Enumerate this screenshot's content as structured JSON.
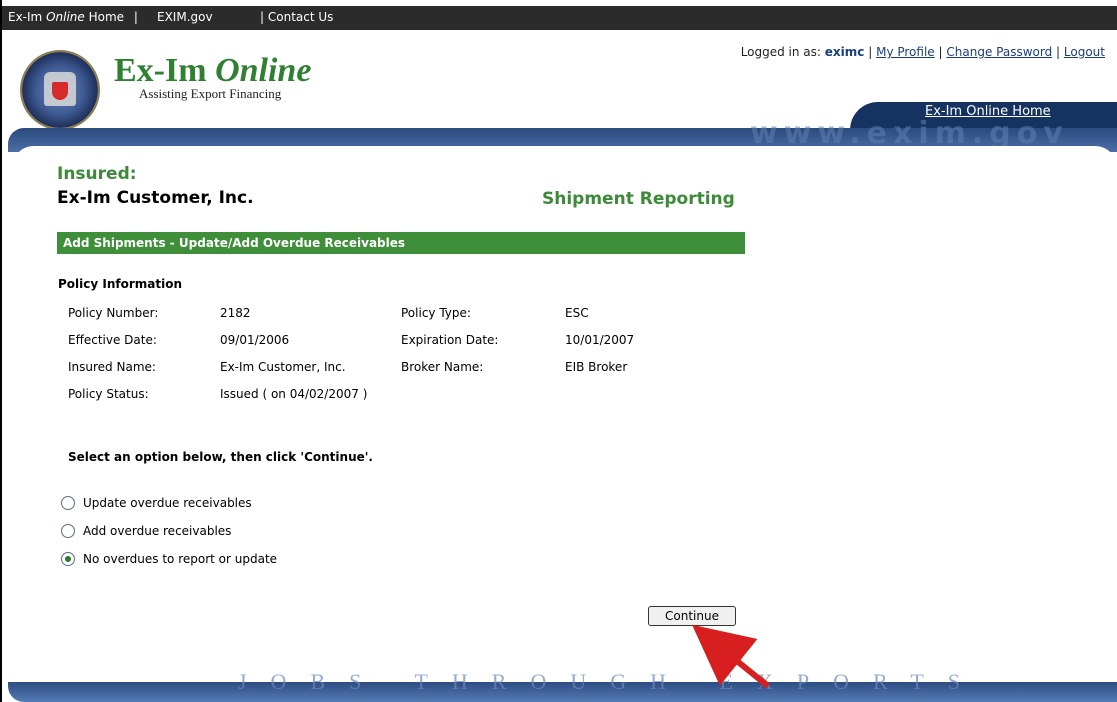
{
  "top_bar": {
    "home_pre": "Ex-Im ",
    "home_italic": "Online",
    "home_post": " Home",
    "exim": "EXIM.gov",
    "contact": "Contact Us",
    "sep": "|"
  },
  "brand": {
    "title_left": "Ex-Im ",
    "title_right": "Online",
    "tagline": "Assisting Export Financing",
    "watermark": "www.exim.gov",
    "footer_watermark": "JOBS THROUGH EXPORTS"
  },
  "user_bar": {
    "prefix": "Logged in as: ",
    "user": "eximc",
    "my_profile": "My Profile",
    "change_password": "Change Password",
    "logout": "Logout",
    "sep": "|"
  },
  "home_tab": {
    "label": "Ex-Im Online Home"
  },
  "page": {
    "insured_label": "Insured:",
    "insured_name": "Ex-Im Customer, Inc.",
    "section_title": "Shipment Reporting",
    "bar_title": "Add Shipments - Update/Add Overdue Receivables"
  },
  "policy": {
    "title": "Policy Information",
    "rows": [
      [
        "Policy Number:",
        "2182",
        "Policy Type:",
        "ESC"
      ],
      [
        "Effective Date:",
        "09/01/2006",
        "Expiration Date:",
        "10/01/2007"
      ],
      [
        "Insured Name:",
        "Ex-Im Customer, Inc.",
        "Broker Name:",
        "EIB Broker"
      ],
      [
        "Policy Status:",
        "Issued ( on 04/02/2007 )",
        "",
        ""
      ]
    ]
  },
  "instruction": "Select an option below, then click 'Continue'.",
  "options": [
    {
      "label": "Update overdue receivables",
      "checked": false
    },
    {
      "label": "Add overdue receivables",
      "checked": false
    },
    {
      "label": "No overdues to report or update",
      "checked": true
    }
  ],
  "continue_label": "Continue",
  "colors": {
    "green": "#3f8f3a",
    "navy": "#163260",
    "dark_bar": "#2b2b2b"
  }
}
